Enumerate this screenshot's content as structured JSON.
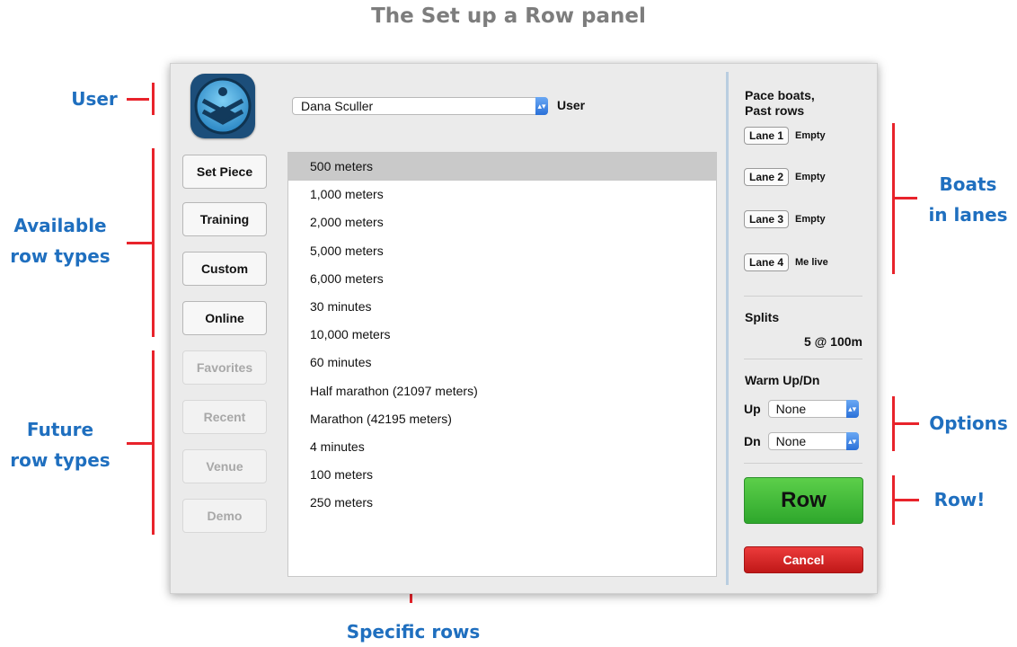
{
  "title": "The Set up a Row panel",
  "annotations": {
    "user": "User",
    "available_1": "Available",
    "available_2": "row types",
    "future_1": "Future",
    "future_2": "row types",
    "boats_1": "Boats",
    "boats_2": "in lanes",
    "options": "Options",
    "row": "Row!",
    "specific": "Specific rows"
  },
  "user": {
    "selected": "Dana Sculler",
    "label": "User"
  },
  "row_types": [
    {
      "label": "Set Piece",
      "enabled": true
    },
    {
      "label": "Training",
      "enabled": true
    },
    {
      "label": "Custom",
      "enabled": true
    },
    {
      "label": "Online",
      "enabled": true
    },
    {
      "label": "Favorites",
      "enabled": false
    },
    {
      "label": "Recent",
      "enabled": false
    },
    {
      "label": "Venue",
      "enabled": false
    },
    {
      "label": "Demo",
      "enabled": false
    }
  ],
  "rows": [
    "500 meters",
    "1,000 meters",
    "2,000 meters",
    "5,000 meters",
    "6,000 meters",
    "30 minutes",
    "10,000 meters",
    "60 minutes",
    "Half marathon (21097 meters)",
    "Marathon (42195 meters)",
    "4 minutes",
    "100 meters",
    "250 meters"
  ],
  "selected_row_index": 0,
  "pace": {
    "heading_1": "Pace boats,",
    "heading_2": "Past rows",
    "lanes": [
      {
        "label": "Lane 1",
        "status": "Empty"
      },
      {
        "label": "Lane 2",
        "status": "Empty"
      },
      {
        "label": "Lane 3",
        "status": "Empty"
      },
      {
        "label": "Lane 4",
        "status": "Me live"
      }
    ]
  },
  "splits": {
    "label": "Splits",
    "value": "5 @ 100m"
  },
  "warm": {
    "label": "Warm Up/Dn",
    "up_label": "Up",
    "up_value": "None",
    "dn_label": "Dn",
    "dn_value": "None"
  },
  "actions": {
    "row": "Row",
    "cancel": "Cancel"
  },
  "colors": {
    "annotation": "#1f6fbf",
    "bracket": "#e8232b",
    "row_button": "#3cb837",
    "cancel_button": "#d42020"
  }
}
